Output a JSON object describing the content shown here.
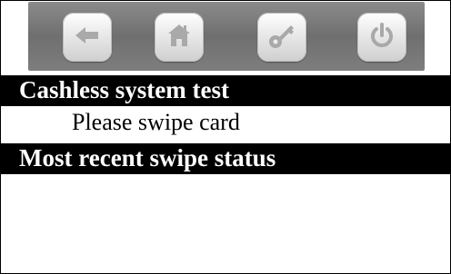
{
  "toolbar": {
    "buttons": [
      {
        "icon": "back-arrow-icon"
      },
      {
        "icon": "home-icon"
      },
      {
        "icon": "key-icon"
      },
      {
        "icon": "power-icon"
      }
    ],
    "icon_color": "#aaaaaa"
  },
  "cashless_test": {
    "title": "Cashless system test",
    "prompt": "Please swipe card"
  },
  "recent_swipe": {
    "title": "Most recent swipe status"
  }
}
